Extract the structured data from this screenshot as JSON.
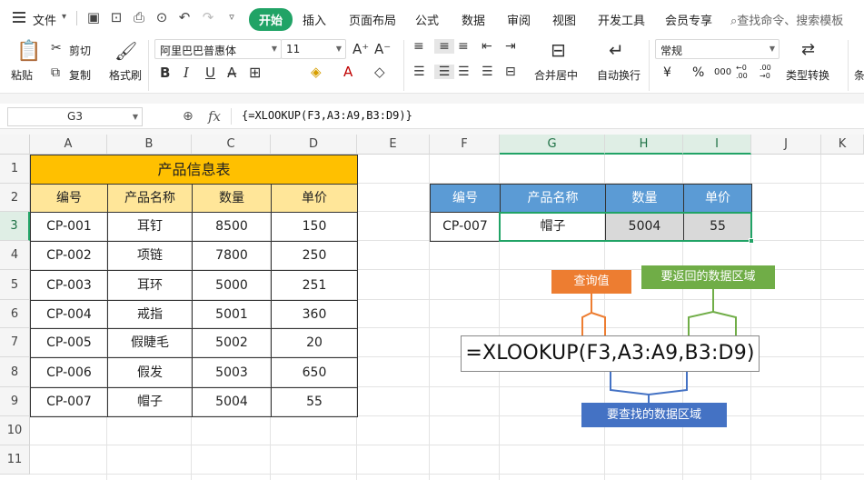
{
  "menubar": {
    "file_label": "文件",
    "tabs": [
      "开始",
      "插入",
      "页面布局",
      "公式",
      "数据",
      "审阅",
      "视图",
      "开发工具",
      "会员专享"
    ],
    "active_tab": "开始",
    "search_placeholder": "查找命令、搜索模板"
  },
  "ribbon": {
    "paste_label": "粘贴",
    "cut_label": "剪切",
    "copy_label": "复制",
    "format_painter_label": "格式刷",
    "font_name": "阿里巴巴普惠体",
    "font_size": "11",
    "merge_label": "合并居中",
    "wrap_label": "自动换行",
    "number_format": "常规",
    "type_convert_label": "类型转换",
    "currency_symbol": "¥",
    "percent_symbol": "%",
    "thousands_symbol": "000",
    "dec_increase": "←0 .00",
    "dec_decrease": ".00 →0",
    "more_label": "条"
  },
  "formula_bar": {
    "cell_ref": "G3",
    "fx": "fx",
    "formula": "{=XLOOKUP(F3,A3:A9,B3:D9)}"
  },
  "sheet": {
    "columns": [
      "A",
      "B",
      "C",
      "D",
      "E",
      "F",
      "G",
      "H",
      "I",
      "J",
      "K"
    ],
    "rows": [
      "1",
      "2",
      "3",
      "4",
      "5",
      "6",
      "7",
      "8",
      "9",
      "10",
      "11"
    ],
    "selected_columns": [
      "G",
      "H",
      "I"
    ],
    "selected_row": "3",
    "table_title": "产品信息表",
    "table_headers": [
      "编号",
      "产品名称",
      "数量",
      "单价"
    ],
    "table_rows": [
      [
        "CP-001",
        "耳钉",
        "8500",
        "150"
      ],
      [
        "CP-002",
        "项链",
        "7800",
        "250"
      ],
      [
        "CP-003",
        "耳环",
        "5000",
        "251"
      ],
      [
        "CP-004",
        "戒指",
        "5001",
        "360"
      ],
      [
        "CP-005",
        "假睫毛",
        "5002",
        "20"
      ],
      [
        "CP-006",
        "假发",
        "5003",
        "650"
      ],
      [
        "CP-007",
        "帽子",
        "5004",
        "55"
      ]
    ],
    "lookup_headers": [
      "编号",
      "产品名称",
      "数量",
      "单价"
    ],
    "lookup_row": [
      "CP-007",
      "帽子",
      "5004",
      "55"
    ]
  },
  "annotation": {
    "formula": "=XLOOKUP(F3,A3:A9,B3:D9)",
    "lookup_value_label": "查询值",
    "return_range_label": "要返回的数据区域",
    "lookup_range_label": "要查找的数据区域",
    "colors": {
      "orange": "#ed7d31",
      "green": "#70ad47",
      "blue": "#4472c4"
    }
  },
  "colors": {
    "accent_green": "#21a366",
    "title_fill": "#ffc000",
    "header_fill": "#ffe699",
    "lookup_header_fill": "#5b9bd5",
    "result_fill": "#d9d9d9"
  }
}
